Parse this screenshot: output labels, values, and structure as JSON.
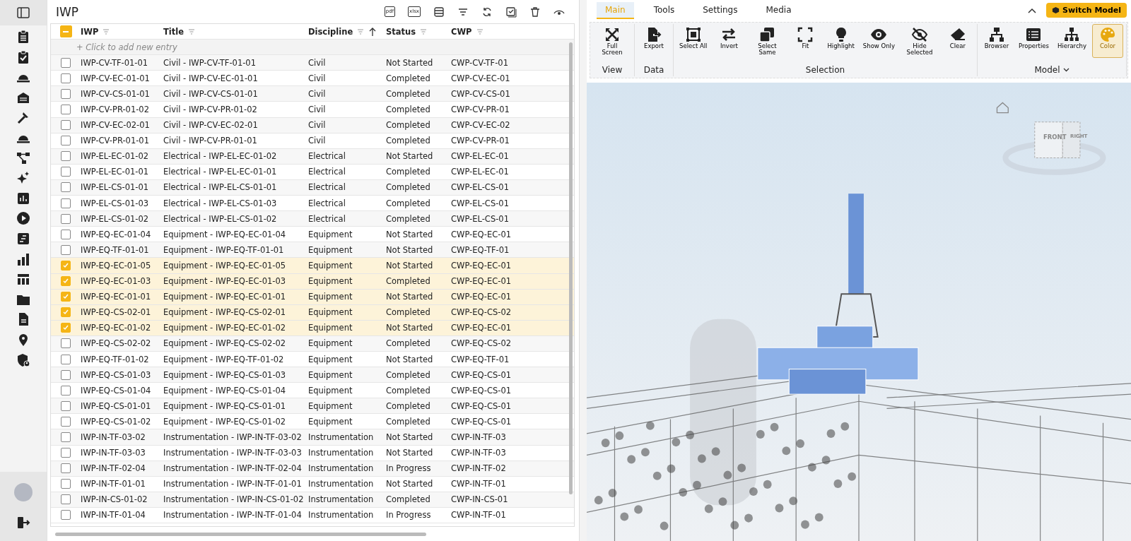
{
  "panel": {
    "title": "IWP",
    "toolbar": [
      {
        "kind": "pdf",
        "label": "pdf"
      },
      {
        "kind": "xlsx",
        "label": "xlsx"
      },
      {
        "kind": "columns"
      },
      {
        "kind": "filter"
      },
      {
        "kind": "refresh"
      },
      {
        "kind": "check"
      },
      {
        "kind": "trash"
      },
      {
        "kind": "eye"
      }
    ]
  },
  "table": {
    "select_all": {
      "indeterminate": true
    },
    "columns": [
      {
        "label": "IWP",
        "sorted": false
      },
      {
        "label": "Title",
        "sorted": false
      },
      {
        "label": "Discipline",
        "sorted": true
      },
      {
        "label": "Status",
        "sorted": false
      },
      {
        "label": "CWP",
        "sorted": false
      }
    ],
    "add_entry": "+ Click to add new entry",
    "rows": [
      {
        "iwp": "IWP-CV-TF-01-01",
        "title": "Civil - IWP-CV-TF-01-01",
        "discipline": "Civil",
        "status": "Not Started",
        "cwp": "CWP-CV-TF-01",
        "checked": false
      },
      {
        "iwp": "IWP-CV-EC-01-01",
        "title": "Civil - IWP-CV-EC-01-01",
        "discipline": "Civil",
        "status": "Completed",
        "cwp": "CWP-CV-EC-01",
        "checked": false
      },
      {
        "iwp": "IWP-CV-CS-01-01",
        "title": "Civil - IWP-CV-CS-01-01",
        "discipline": "Civil",
        "status": "Completed",
        "cwp": "CWP-CV-CS-01",
        "checked": false
      },
      {
        "iwp": "IWP-CV-PR-01-02",
        "title": "Civil - IWP-CV-PR-01-02",
        "discipline": "Civil",
        "status": "Completed",
        "cwp": "CWP-CV-PR-01",
        "checked": false
      },
      {
        "iwp": "IWP-CV-EC-02-01",
        "title": "Civil - IWP-CV-EC-02-01",
        "discipline": "Civil",
        "status": "Completed",
        "cwp": "CWP-CV-EC-02",
        "checked": false
      },
      {
        "iwp": "IWP-CV-PR-01-01",
        "title": "Civil - IWP-CV-PR-01-01",
        "discipline": "Civil",
        "status": "Completed",
        "cwp": "CWP-CV-PR-01",
        "checked": false
      },
      {
        "iwp": "IWP-EL-EC-01-02",
        "title": "Electrical - IWP-EL-EC-01-02",
        "discipline": "Electrical",
        "status": "Not Started",
        "cwp": "CWP-EL-EC-01",
        "checked": false
      },
      {
        "iwp": "IWP-EL-EC-01-01",
        "title": "Electrical - IWP-EL-EC-01-01",
        "discipline": "Electrical",
        "status": "Completed",
        "cwp": "CWP-EL-EC-01",
        "checked": false
      },
      {
        "iwp": "IWP-EL-CS-01-01",
        "title": "Electrical - IWP-EL-CS-01-01",
        "discipline": "Electrical",
        "status": "Completed",
        "cwp": "CWP-EL-CS-01",
        "checked": false
      },
      {
        "iwp": "IWP-EL-CS-01-03",
        "title": "Electrical - IWP-EL-CS-01-03",
        "discipline": "Electrical",
        "status": "Completed",
        "cwp": "CWP-EL-CS-01",
        "checked": false
      },
      {
        "iwp": "IWP-EL-CS-01-02",
        "title": "Electrical - IWP-EL-CS-01-02",
        "discipline": "Electrical",
        "status": "Completed",
        "cwp": "CWP-EL-CS-01",
        "checked": false
      },
      {
        "iwp": "IWP-EQ-EC-01-04",
        "title": "Equipment - IWP-EQ-EC-01-04",
        "discipline": "Equipment",
        "status": "Not Started",
        "cwp": "CWP-EQ-EC-01",
        "checked": false
      },
      {
        "iwp": "IWP-EQ-TF-01-01",
        "title": "Equipment - IWP-EQ-TF-01-01",
        "discipline": "Equipment",
        "status": "Not Started",
        "cwp": "CWP-EQ-TF-01",
        "checked": false
      },
      {
        "iwp": "IWP-EQ-EC-01-05",
        "title": "Equipment - IWP-EQ-EC-01-05",
        "discipline": "Equipment",
        "status": "Not Started",
        "cwp": "CWP-EQ-EC-01",
        "checked": true
      },
      {
        "iwp": "IWP-EQ-EC-01-03",
        "title": "Equipment - IWP-EQ-EC-01-03",
        "discipline": "Equipment",
        "status": "Completed",
        "cwp": "CWP-EQ-EC-01",
        "checked": true
      },
      {
        "iwp": "IWP-EQ-EC-01-01",
        "title": "Equipment - IWP-EQ-EC-01-01",
        "discipline": "Equipment",
        "status": "Not Started",
        "cwp": "CWP-EQ-EC-01",
        "checked": true
      },
      {
        "iwp": "IWP-EQ-CS-02-01",
        "title": "Equipment - IWP-EQ-CS-02-01",
        "discipline": "Equipment",
        "status": "Completed",
        "cwp": "CWP-EQ-CS-02",
        "checked": true
      },
      {
        "iwp": "IWP-EQ-EC-01-02",
        "title": "Equipment - IWP-EQ-EC-01-02",
        "discipline": "Equipment",
        "status": "Not Started",
        "cwp": "CWP-EQ-EC-01",
        "checked": true
      },
      {
        "iwp": "IWP-EQ-CS-02-02",
        "title": "Equipment - IWP-EQ-CS-02-02",
        "discipline": "Equipment",
        "status": "Completed",
        "cwp": "CWP-EQ-CS-02",
        "checked": false
      },
      {
        "iwp": "IWP-EQ-TF-01-02",
        "title": "Equipment - IWP-EQ-TF-01-02",
        "discipline": "Equipment",
        "status": "Not Started",
        "cwp": "CWP-EQ-TF-01",
        "checked": false
      },
      {
        "iwp": "IWP-EQ-CS-01-03",
        "title": "Equipment - IWP-EQ-CS-01-03",
        "discipline": "Equipment",
        "status": "Completed",
        "cwp": "CWP-EQ-CS-01",
        "checked": false
      },
      {
        "iwp": "IWP-EQ-CS-01-04",
        "title": "Equipment - IWP-EQ-CS-01-04",
        "discipline": "Equipment",
        "status": "Completed",
        "cwp": "CWP-EQ-CS-01",
        "checked": false
      },
      {
        "iwp": "IWP-EQ-CS-01-01",
        "title": "Equipment - IWP-EQ-CS-01-01",
        "discipline": "Equipment",
        "status": "Completed",
        "cwp": "CWP-EQ-CS-01",
        "checked": false
      },
      {
        "iwp": "IWP-EQ-CS-01-02",
        "title": "Equipment - IWP-EQ-CS-01-02",
        "discipline": "Equipment",
        "status": "Completed",
        "cwp": "CWP-EQ-CS-01",
        "checked": false
      },
      {
        "iwp": "IWP-IN-TF-03-02",
        "title": "Instrumentation - IWP-IN-TF-03-02",
        "discipline": "Instrumentation",
        "status": "Not Started",
        "cwp": "CWP-IN-TF-03",
        "checked": false
      },
      {
        "iwp": "IWP-IN-TF-03-03",
        "title": "Instrumentation - IWP-IN-TF-03-03",
        "discipline": "Instrumentation",
        "status": "Not Started",
        "cwp": "CWP-IN-TF-03",
        "checked": false
      },
      {
        "iwp": "IWP-IN-TF-02-04",
        "title": "Instrumentation - IWP-IN-TF-02-04",
        "discipline": "Instrumentation",
        "status": "In Progress",
        "cwp": "CWP-IN-TF-02",
        "checked": false
      },
      {
        "iwp": "IWP-IN-TF-01-01",
        "title": "Instrumentation - IWP-IN-TF-01-01",
        "discipline": "Instrumentation",
        "status": "Not Started",
        "cwp": "CWP-IN-TF-01",
        "checked": false
      },
      {
        "iwp": "IWP-IN-CS-01-02",
        "title": "Instrumentation - IWP-IN-CS-01-02",
        "discipline": "Instrumentation",
        "status": "Completed",
        "cwp": "CWP-IN-CS-01",
        "checked": false
      },
      {
        "iwp": "IWP-IN-TF-01-04",
        "title": "Instrumentation - IWP-IN-TF-01-04",
        "discipline": "Instrumentation",
        "status": "In Progress",
        "cwp": "CWP-IN-TF-01",
        "checked": false
      }
    ]
  },
  "viewer": {
    "tabs": [
      {
        "label": "Main",
        "selected": true
      },
      {
        "label": "Tools",
        "selected": false
      },
      {
        "label": "Settings",
        "selected": false
      },
      {
        "label": "Media",
        "selected": false
      }
    ],
    "switch_model": "Switch Model",
    "groups": [
      {
        "label": "View",
        "dropdown": false,
        "buttons": [
          {
            "kind": "fullscreen",
            "label": "Full Screen",
            "selected": false
          }
        ]
      },
      {
        "label": "Data",
        "dropdown": false,
        "buttons": [
          {
            "kind": "export",
            "label": "Export",
            "selected": false
          }
        ]
      },
      {
        "label": "Selection",
        "dropdown": false,
        "buttons": [
          {
            "kind": "selectall",
            "label": "Select All",
            "selected": false
          },
          {
            "kind": "invert",
            "label": "Invert",
            "selected": false
          },
          {
            "kind": "same",
            "label": "Select Same",
            "selected": false
          },
          {
            "kind": "fit",
            "label": "Fit",
            "selected": false
          },
          {
            "kind": "bulb",
            "label": "Highlight",
            "selected": false
          },
          {
            "kind": "eye",
            "label": "Show Only",
            "selected": false
          },
          {
            "kind": "eyeoff",
            "label": "Hide Selected",
            "selected": false
          },
          {
            "kind": "eraser",
            "label": "Clear",
            "selected": false
          }
        ]
      },
      {
        "label": "Model",
        "dropdown": true,
        "buttons": [
          {
            "kind": "tree",
            "label": "Browser",
            "selected": false
          },
          {
            "kind": "list",
            "label": "Properties",
            "selected": false
          },
          {
            "kind": "hierarchy",
            "label": "Hierarchy",
            "selected": false
          },
          {
            "kind": "palette",
            "label": "Color",
            "selected": true
          }
        ]
      }
    ],
    "view_cube": {
      "front": "FRONT",
      "right": "RIGHT"
    }
  }
}
